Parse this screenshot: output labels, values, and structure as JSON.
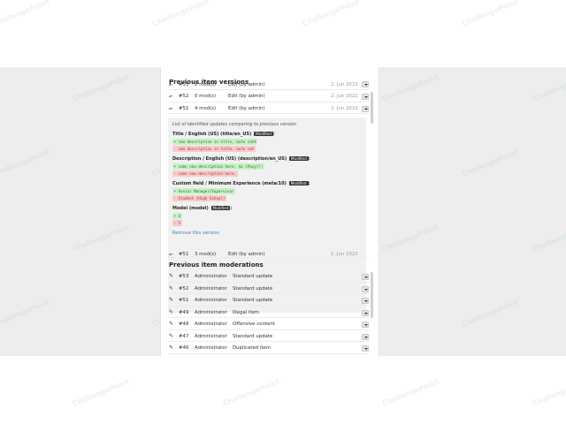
{
  "watermark": "ChallengePoint",
  "versions": {
    "title": "Previous item versions",
    "rows": [
      {
        "icon": "branch-icon",
        "id": "#53",
        "mods": "2 mod(s)",
        "action": "Edit (by admin)",
        "date": "2. Jun 2022",
        "toggle": "down"
      },
      {
        "icon": "branch-icon",
        "id": "#52",
        "mods": "0 mod(s)",
        "action": "Edit (by admin)",
        "date": "2. Jun 2022",
        "toggle": "down"
      },
      {
        "icon": "branch-icon",
        "id": "#51",
        "mods": "4 mod(s)",
        "action": "Edit (by admin)",
        "date": "2. Jun 2022",
        "toggle": "up"
      }
    ],
    "details": {
      "intro": "List of identified updates comparing to previous version",
      "badge": "Modified",
      "changes": [
        {
          "field": "Title / English (US) (title/en_US)",
          "added": "+ new description in title, auto catX",
          "removed": "- new description in title, auto cat"
        },
        {
          "field": "Description / English (US) (description/en_US)",
          "added": "+ some new description here, no (Pazy)!!",
          "removed": "- some new description here."
        },
        {
          "field": "Custom field / Minimum Experience (meta/10)",
          "added": "+ Senior Manager/Supervisor",
          "removed": "- Student (High School)"
        },
        {
          "field": "Model (model)",
          "added": "+ 4",
          "removed": "- 5"
        }
      ],
      "remove_label": "Remove this version"
    },
    "after_row": {
      "icon": "branch-icon",
      "id": "#51",
      "mods": "3 mod(s)",
      "action": "Edit (by admin)",
      "date": "1. Jun 2022",
      "toggle": "down"
    }
  },
  "moderations": {
    "title": "Previous item moderations",
    "rows": [
      {
        "icon": "edit-icon",
        "id": "#53",
        "user": "Administrator",
        "reason": "Standard update"
      },
      {
        "icon": "edit-icon",
        "id": "#52",
        "user": "Administrator",
        "reason": "Standard update"
      },
      {
        "icon": "edit-icon",
        "id": "#51",
        "user": "Administrator",
        "reason": "Standard update"
      },
      {
        "icon": "edit-icon",
        "id": "#49",
        "user": "Administrator",
        "reason": "Illegal item"
      },
      {
        "icon": "edit-icon",
        "id": "#48",
        "user": "Administrator",
        "reason": "Offensive content"
      },
      {
        "icon": "edit-icon",
        "id": "#47",
        "user": "Administrator",
        "reason": "Standard update"
      },
      {
        "icon": "edit-icon",
        "id": "#46",
        "user": "Administrator",
        "reason": "Duplicated item"
      }
    ]
  }
}
